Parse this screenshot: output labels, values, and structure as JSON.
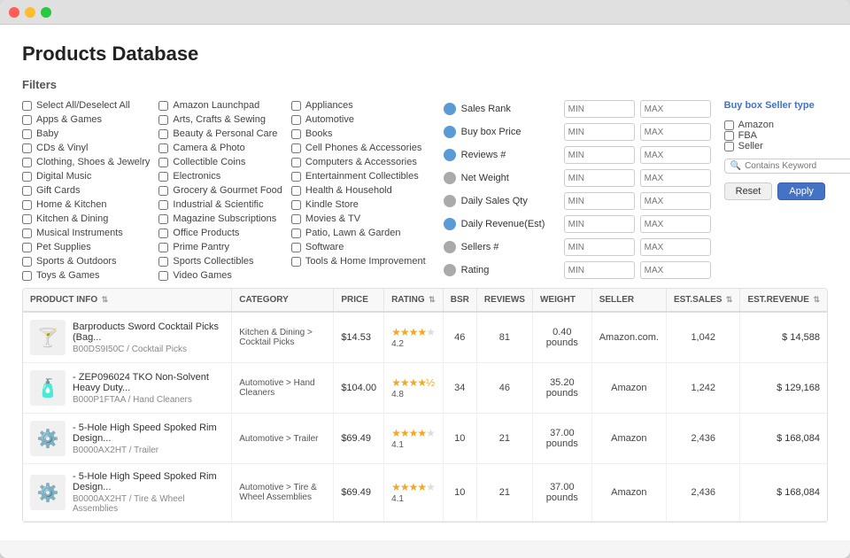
{
  "window": {
    "title": "Products Database"
  },
  "header": {
    "page_title": "Products Database",
    "filters_label": "Filters"
  },
  "filters": {
    "col1": [
      {
        "label": "Select All/Deselect All",
        "checked": false
      },
      {
        "label": "Apps & Games",
        "checked": false
      },
      {
        "label": "Baby",
        "checked": false
      },
      {
        "label": "CDs & Vinyl",
        "checked": false
      },
      {
        "label": "Clothing, Shoes & Jewelry",
        "checked": false
      },
      {
        "label": "Digital Music",
        "checked": false
      },
      {
        "label": "Gift Cards",
        "checked": false
      },
      {
        "label": "Home & Kitchen",
        "checked": false
      },
      {
        "label": "Kitchen & Dining",
        "checked": false
      },
      {
        "label": "Musical Instruments",
        "checked": false
      },
      {
        "label": "Pet Supplies",
        "checked": false
      },
      {
        "label": "Sports & Outdoors",
        "checked": false
      },
      {
        "label": "Toys & Games",
        "checked": false
      }
    ],
    "col2": [
      {
        "label": "Amazon Launchpad",
        "checked": false
      },
      {
        "label": "Arts, Crafts & Sewing",
        "checked": false
      },
      {
        "label": "Beauty & Personal Care",
        "checked": false
      },
      {
        "label": "Camera & Photo",
        "checked": false
      },
      {
        "label": "Collectible Coins",
        "checked": false
      },
      {
        "label": "Electronics",
        "checked": false
      },
      {
        "label": "Grocery & Gourmet Food",
        "checked": false
      },
      {
        "label": "Industrial & Scientific",
        "checked": false
      },
      {
        "label": "Magazine Subscriptions",
        "checked": false
      },
      {
        "label": "Office Products",
        "checked": false
      },
      {
        "label": "Prime Pantry",
        "checked": false
      },
      {
        "label": "Sports Collectibles",
        "checked": false
      },
      {
        "label": "Video Games",
        "checked": false
      }
    ],
    "col3": [
      {
        "label": "Appliances",
        "checked": false
      },
      {
        "label": "Automotive",
        "checked": false
      },
      {
        "label": "Books",
        "checked": false
      },
      {
        "label": "Cell Phones & Accessories",
        "checked": false
      },
      {
        "label": "Computers & Accessories",
        "checked": false
      },
      {
        "label": "Entertainment Collectibles",
        "checked": false
      },
      {
        "label": "Health & Household",
        "checked": false
      },
      {
        "label": "Kindle Store",
        "checked": false
      },
      {
        "label": "Movies & TV",
        "checked": false
      },
      {
        "label": "Patio, Lawn & Garden",
        "checked": false
      },
      {
        "label": "Software",
        "checked": false
      },
      {
        "label": "Tools & Home Improvement",
        "checked": false
      }
    ],
    "ranges": [
      {
        "label": "Sales Rank",
        "active": true
      },
      {
        "label": "Buy box Price",
        "active": true
      },
      {
        "label": "Reviews #",
        "active": true
      },
      {
        "label": "Net Weight",
        "active": false
      },
      {
        "label": "Daily Sales Qty",
        "active": false
      },
      {
        "label": "Daily Revenue(Est)",
        "active": true
      },
      {
        "label": "Sellers #",
        "active": false
      },
      {
        "label": "Rating",
        "active": false
      }
    ],
    "range_min_placeholder": "MIN",
    "range_max_placeholder": "MAX",
    "seller_type": {
      "title": "Buy box Seller type",
      "options": [
        {
          "label": "Amazon",
          "checked": false
        },
        {
          "label": "FBA",
          "checked": false
        },
        {
          "label": "Seller",
          "checked": false
        }
      ]
    },
    "keyword_placeholder": "Contains Keyword",
    "reset_label": "Reset",
    "apply_label": "Apply"
  },
  "table": {
    "columns": [
      {
        "label": "PRODUCT INFO",
        "sortable": true
      },
      {
        "label": "CATEGORY",
        "sortable": false
      },
      {
        "label": "PRICE",
        "sortable": false
      },
      {
        "label": "RATING",
        "sortable": true
      },
      {
        "label": "BSR",
        "sortable": false
      },
      {
        "label": "REVIEWS",
        "sortable": false
      },
      {
        "label": "WEIGHT",
        "sortable": false
      },
      {
        "label": "SELLER",
        "sortable": false
      },
      {
        "label": "EST.SALES",
        "sortable": true
      },
      {
        "label": "EST.REVENUE",
        "sortable": true
      }
    ],
    "rows": [
      {
        "id": 1,
        "name": "Barproducts Sword Cocktail Picks (Bag...",
        "sku": "B00DS9I50C / Cocktail Picks",
        "category": "Kitchen & Dining > Cocktail Picks",
        "price": "$14.53",
        "rating_stars": 4.2,
        "rating_val": "4.2",
        "bsr": "46",
        "reviews": "81",
        "weight": "0.40 pounds",
        "seller": "Amazon.com.",
        "est_sales": "1,042",
        "est_revenue": "$ 14,588",
        "img_char": "🍸"
      },
      {
        "id": 2,
        "name": "- ZEP096024 TKO Non-Solvent Heavy Duty...",
        "sku": "B000P1FTAA / Hand Cleaners",
        "category": "Automotive > Hand Cleaners",
        "price": "$104.00",
        "rating_stars": 4.8,
        "rating_val": "4.8",
        "bsr": "34",
        "reviews": "46",
        "weight": "35.20 pounds",
        "seller": "Amazon",
        "est_sales": "1,242",
        "est_revenue": "$ 129,168",
        "img_char": "🧴"
      },
      {
        "id": 3,
        "name": "- 5-Hole High Speed Spoked Rim Design...",
        "sku": "B0000AX2HT / Trailer",
        "category": "Automotive > Trailer",
        "price": "$69.49",
        "rating_stars": 4.1,
        "rating_val": "4.1",
        "bsr": "10",
        "reviews": "21",
        "weight": "37.00 pounds",
        "seller": "Amazon",
        "est_sales": "2,436",
        "est_revenue": "$ 168,084",
        "img_char": "⚙️"
      },
      {
        "id": 4,
        "name": "- 5-Hole High Speed Spoked Rim Design...",
        "sku": "B0000AX2HT / Tire & Wheel Assemblies",
        "category": "Automotive > Tire & Wheel Assemblies",
        "price": "$69.49",
        "rating_stars": 4.1,
        "rating_val": "4.1",
        "bsr": "10",
        "reviews": "21",
        "weight": "37.00 pounds",
        "seller": "Amazon",
        "est_sales": "2,436",
        "est_revenue": "$ 168,084",
        "img_char": "⚙️"
      }
    ]
  }
}
